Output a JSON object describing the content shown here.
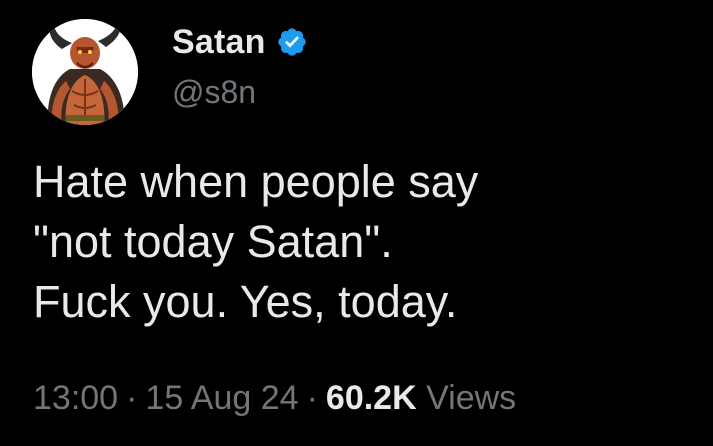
{
  "author": {
    "display_name": "Satan",
    "handle": "@s8n",
    "avatar_icon": "demon-avatar-icon",
    "verified_icon": "verified-badge-icon",
    "verified_color": "#1d9bf0"
  },
  "tweet": {
    "lines": [
      "Hate when people say",
      "\"not today Satan\".",
      "Fuck you. Yes, today."
    ]
  },
  "meta": {
    "time": "13:00",
    "separator": "·",
    "date": "15 Aug 24",
    "views_count": "60.2K",
    "views_label": "Views"
  },
  "colors": {
    "background": "#000000",
    "primary_text": "#e7e9ea",
    "secondary_text": "#71767b"
  }
}
